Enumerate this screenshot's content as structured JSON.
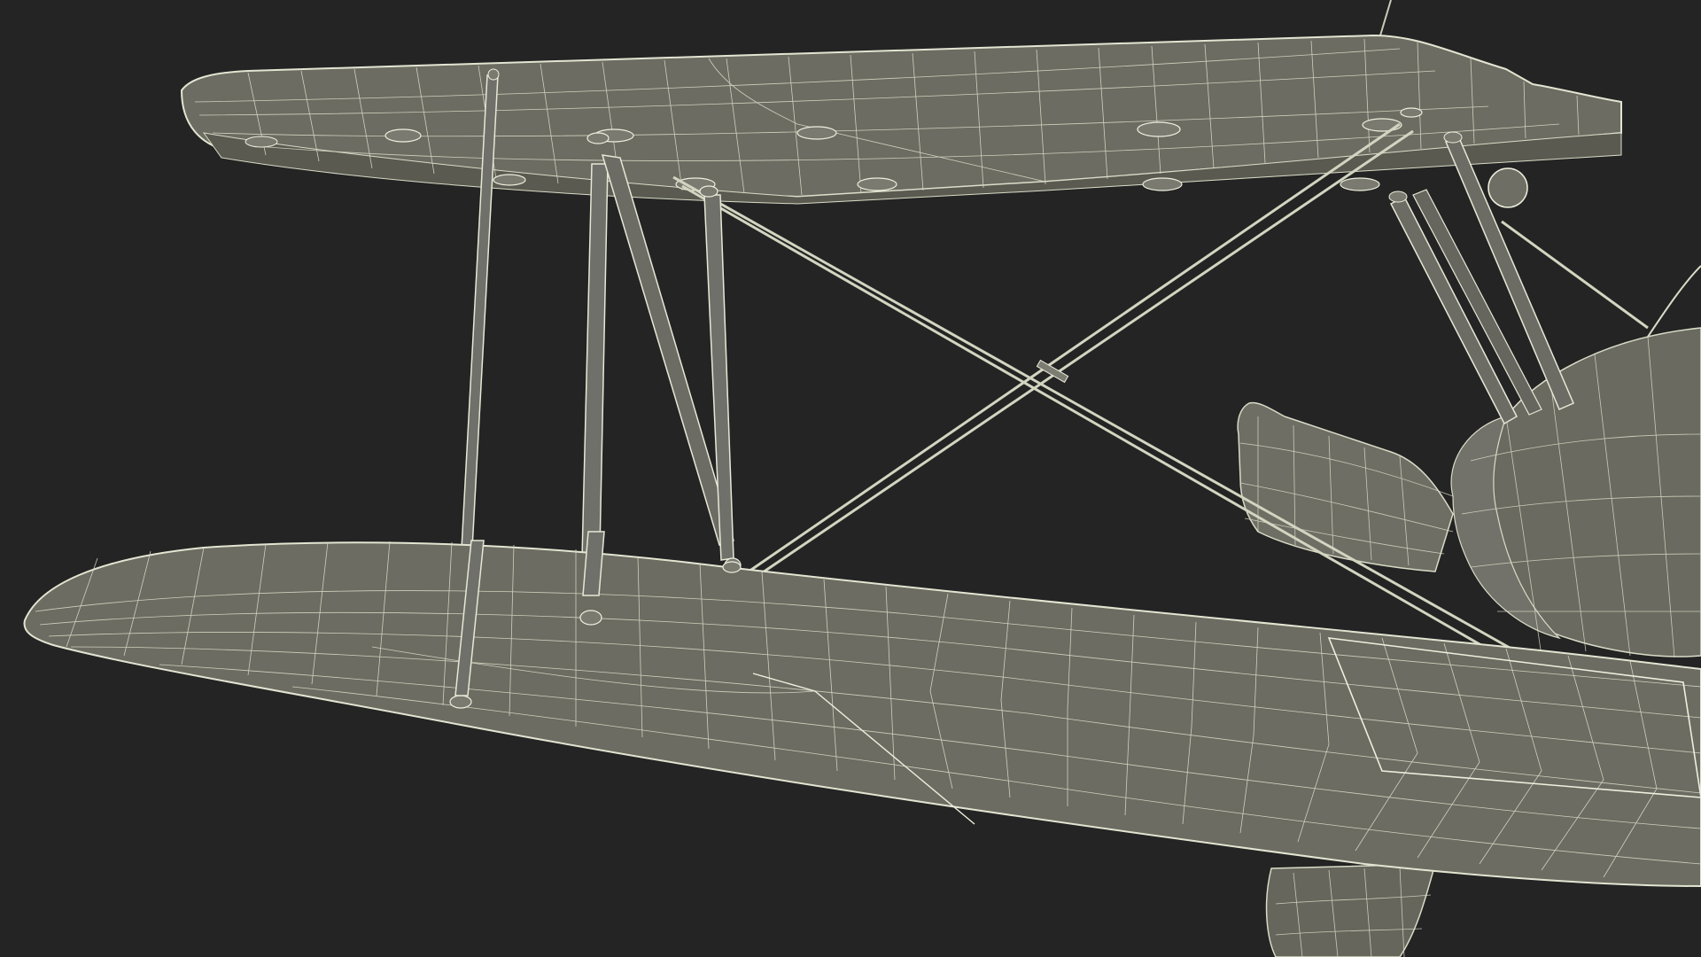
{
  "scene": {
    "subject": "biplane-wireframe-render",
    "colors": {
      "background": "#242424",
      "surface": "#6c6c62",
      "surface_dark": "#5e5e55",
      "surface_light": "#76766c",
      "wire": "#d9dcc7",
      "wire_strong": "#eef0de"
    }
  }
}
